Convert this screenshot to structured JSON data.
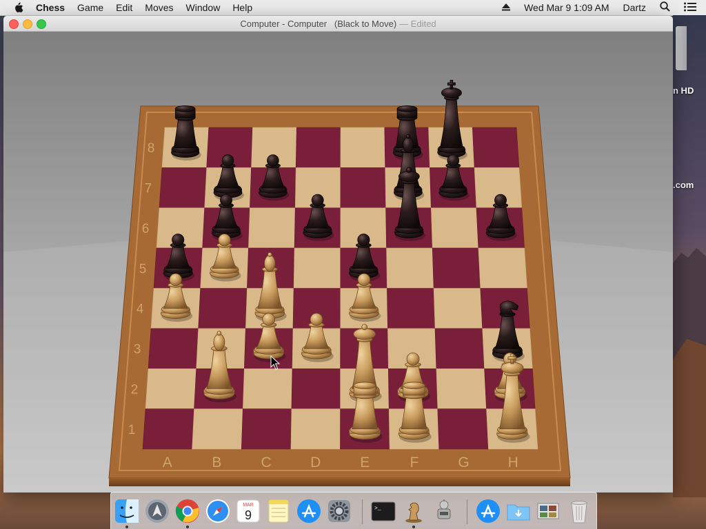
{
  "menubar": {
    "app_name": "Chess",
    "items": [
      "Game",
      "Edit",
      "Moves",
      "Window",
      "Help"
    ],
    "clock": "Wed Mar 9  1:09 AM",
    "user": "Dartz"
  },
  "window": {
    "title": "Computer - Computer   (Black to Move)",
    "edited": "— Edited"
  },
  "desktop": {
    "labels": [
      "n HD",
      ".com"
    ]
  },
  "board": {
    "files": [
      "A",
      "B",
      "C",
      "D",
      "E",
      "F",
      "G",
      "H"
    ],
    "ranks": [
      "8",
      "7",
      "6",
      "5",
      "4",
      "3",
      "2",
      "1"
    ],
    "light_square": "#d9b98a",
    "dark_square": "#7a1f3a",
    "frame": "#a86a34",
    "white_piece": "#c89a5c",
    "black_piece": "#2a1c1c",
    "pieces": [
      {
        "type": "rook",
        "color": "black",
        "square": "a8"
      },
      {
        "type": "rook",
        "color": "black",
        "square": "f8"
      },
      {
        "type": "king",
        "color": "black",
        "square": "g8"
      },
      {
        "type": "pawn",
        "color": "black",
        "square": "b7"
      },
      {
        "type": "pawn",
        "color": "black",
        "square": "c7"
      },
      {
        "type": "bishop",
        "color": "black",
        "square": "f7"
      },
      {
        "type": "pawn",
        "color": "black",
        "square": "g7"
      },
      {
        "type": "pawn",
        "color": "black",
        "square": "b6"
      },
      {
        "type": "pawn",
        "color": "black",
        "square": "d6"
      },
      {
        "type": "queen",
        "color": "black",
        "square": "f6"
      },
      {
        "type": "pawn",
        "color": "black",
        "square": "h6"
      },
      {
        "type": "pawn",
        "color": "black",
        "square": "a5"
      },
      {
        "type": "pawn",
        "color": "black",
        "square": "e5"
      },
      {
        "type": "knight",
        "color": "black",
        "square": "h3"
      },
      {
        "type": "pawn",
        "color": "white",
        "square": "b5"
      },
      {
        "type": "pawn",
        "color": "white",
        "square": "a4"
      },
      {
        "type": "bishop",
        "color": "white",
        "square": "c4"
      },
      {
        "type": "pawn",
        "color": "white",
        "square": "e4"
      },
      {
        "type": "pawn",
        "color": "white",
        "square": "c3"
      },
      {
        "type": "pawn",
        "color": "white",
        "square": "d3"
      },
      {
        "type": "bishop",
        "color": "white",
        "square": "b2"
      },
      {
        "type": "queen",
        "color": "white",
        "square": "e2"
      },
      {
        "type": "pawn",
        "color": "white",
        "square": "f2"
      },
      {
        "type": "pawn",
        "color": "white",
        "square": "h2"
      },
      {
        "type": "rook",
        "color": "white",
        "square": "e1"
      },
      {
        "type": "rook",
        "color": "white",
        "square": "f1"
      },
      {
        "type": "king",
        "color": "white",
        "square": "h1"
      }
    ]
  },
  "dock": {
    "apps": [
      {
        "name": "finder-icon",
        "running": true
      },
      {
        "name": "launchpad-icon",
        "running": false
      },
      {
        "name": "chrome-icon",
        "running": true
      },
      {
        "name": "safari-icon",
        "running": false
      },
      {
        "name": "calendar-icon",
        "running": false,
        "month": "MAR",
        "day": "9"
      },
      {
        "name": "notes-icon",
        "running": false
      },
      {
        "name": "app-store-icon",
        "running": false
      },
      {
        "name": "system-preferences-icon",
        "running": false
      },
      {
        "name": "terminal-icon",
        "running": false
      },
      {
        "name": "chess-icon",
        "running": true
      },
      {
        "name": "automator-icon",
        "running": false
      },
      {
        "name": "downloads-app-store-icon",
        "running": false
      },
      {
        "name": "folder-icon",
        "running": false
      },
      {
        "name": "photos-stack-icon",
        "running": false
      },
      {
        "name": "trash-icon",
        "running": false
      }
    ]
  }
}
